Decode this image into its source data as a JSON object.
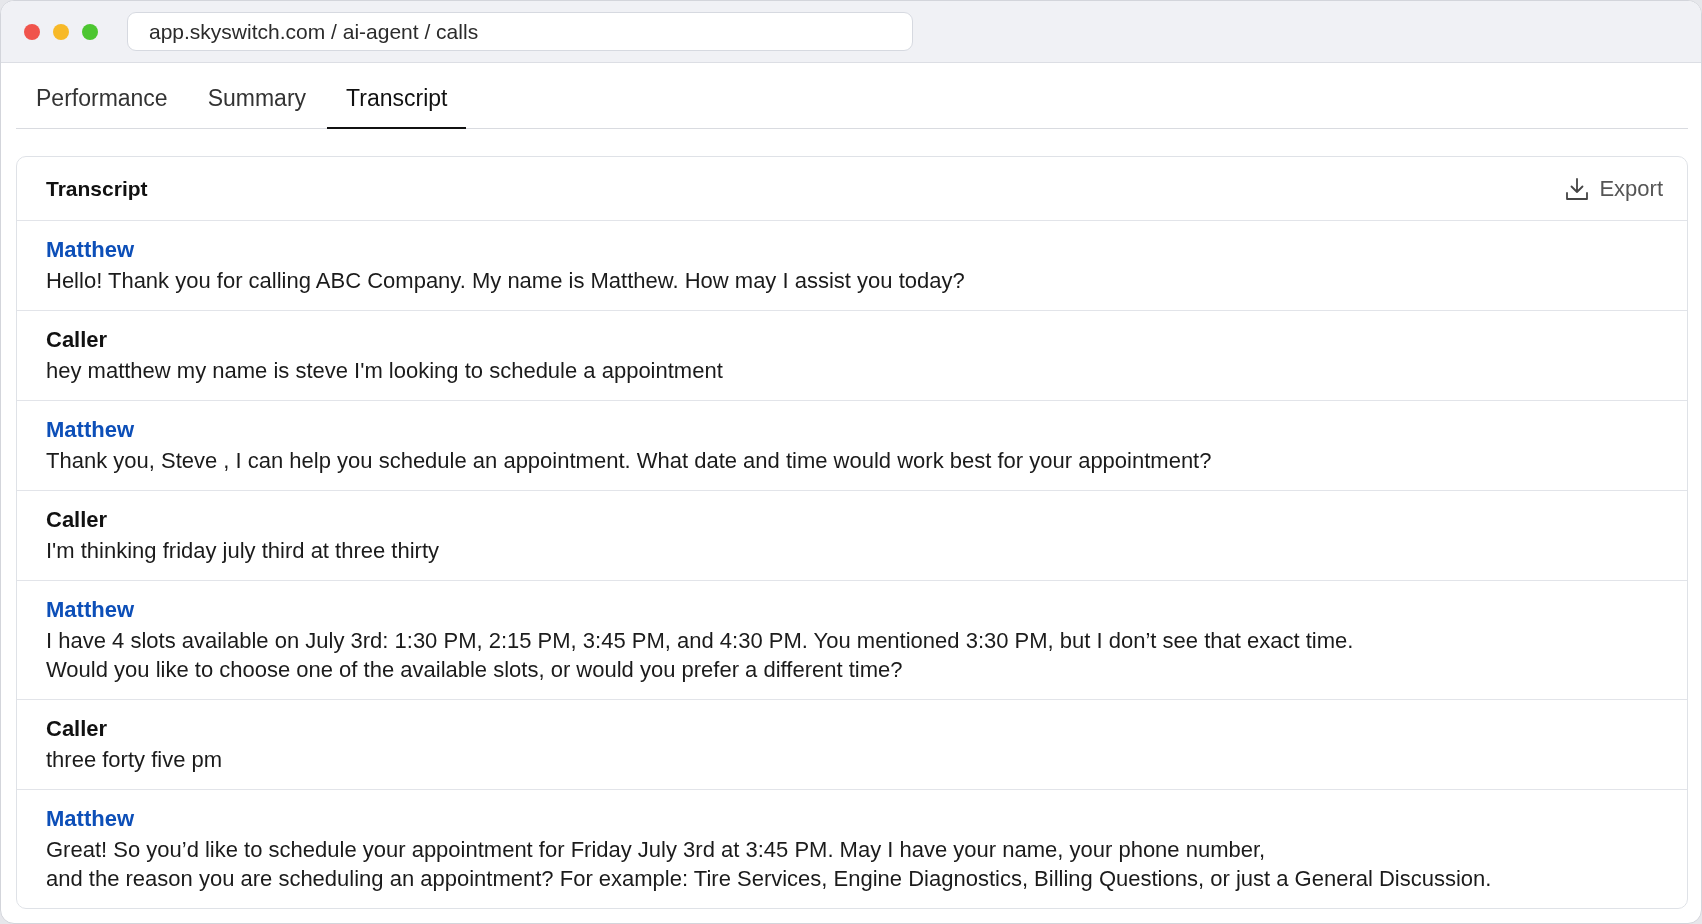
{
  "window": {
    "address": "app.skyswitch.com / ai-agent / calls"
  },
  "tabs": [
    {
      "label": "Performance",
      "selected": false
    },
    {
      "label": "Summary",
      "selected": false
    },
    {
      "label": "Transcript",
      "selected": true
    }
  ],
  "transcript": {
    "title": "Transcript",
    "export_button": "Export",
    "messages": [
      {
        "kind": "agent",
        "speaker": "Matthew",
        "text": "Hello! Thank you for calling ABC Company. My name is Matthew. How may I assist you today?"
      },
      {
        "kind": "caller",
        "speaker": "Caller",
        "text": "hey matthew my name is steve I'm looking to schedule a appointment"
      },
      {
        "kind": "agent",
        "speaker": "Matthew",
        "text": "Thank you, Steve , I can help you schedule an appointment. What date and time would work best for your appointment?"
      },
      {
        "kind": "caller",
        "speaker": "Caller",
        "text": "I'm thinking friday july third at three thirty"
      },
      {
        "kind": "agent",
        "speaker": "Matthew",
        "text": "I have 4 slots available on July 3rd: 1:30 PM, 2:15 PM, 3:45 PM, and 4:30 PM. You mentioned 3:30 PM, but I don’t see that exact time.\nWould you like to choose one of the available slots, or would you prefer a different time?"
      },
      {
        "kind": "caller",
        "speaker": "Caller",
        "text": "three forty five pm"
      },
      {
        "kind": "agent",
        "speaker": "Matthew",
        "text": "Great! So you’d like to schedule your appointment for Friday July 3rd at 3:45 PM. May I have your name, your phone number,\nand the reason you are scheduling an appointment? For example: Tire Services, Engine Diagnostics, Billing Questions, or just a General Discussion."
      }
    ]
  }
}
